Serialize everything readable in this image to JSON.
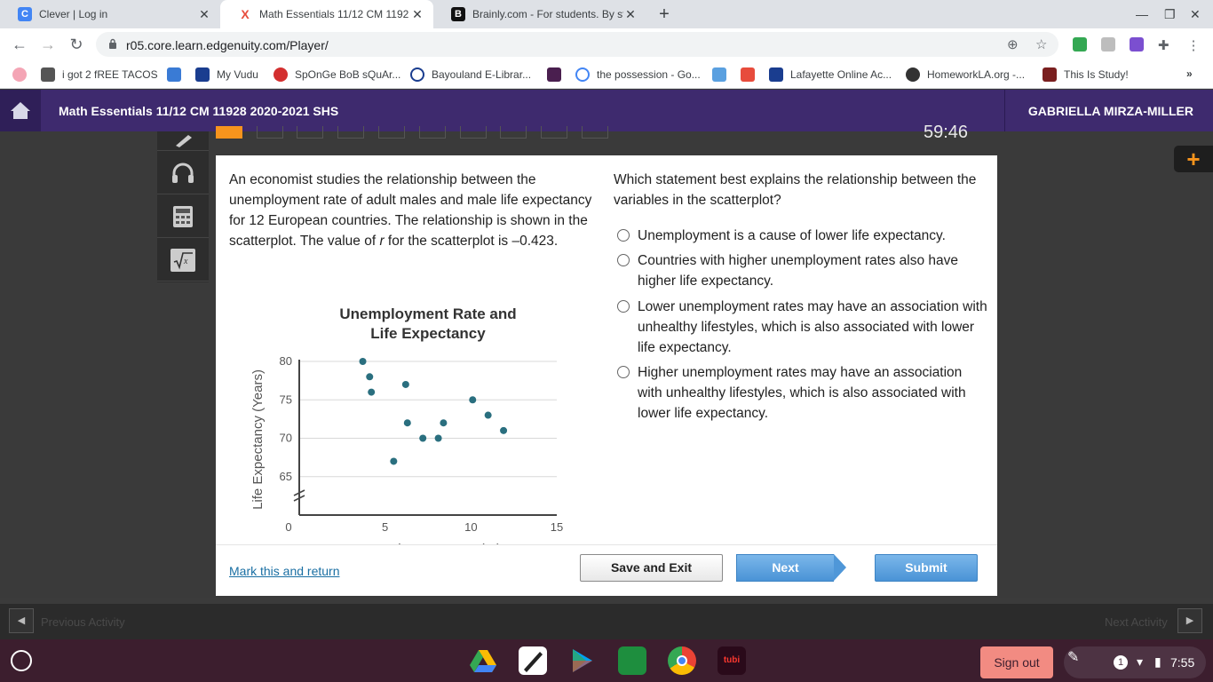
{
  "browser": {
    "tabs": [
      {
        "title": "Clever | Log in",
        "favicon_letter": "C",
        "favicon_color": "#4285f4"
      },
      {
        "title": "Math Essentials 11/12 CM 1192",
        "favicon_letter": "X",
        "favicon_color": "#e74c3c"
      },
      {
        "title": "Brainly.com - For students. By st",
        "favicon_letter": "B",
        "favicon_color": "#111111"
      }
    ],
    "url": "r05.core.learn.edgenuity.com/Player/",
    "bookmarks": [
      "i got 2 fREE TACOS",
      "My Vudu",
      "SpOnGe BoB sQuAr...",
      "Bayouland E-Librar...",
      "the possession - Go...",
      "Lafayette Online Ac...",
      "HomeworkLA.org -...",
      "This Is Study!"
    ]
  },
  "app": {
    "course_title": "Math Essentials 11/12 CM 11928 2020-2021 SHS",
    "user_name": "GABRIELLA MIRZA-MILLER",
    "timer": "59:46"
  },
  "question": {
    "prompt": "An economist studies the relationship between the unemployment rate of adult males and male life expectancy for 12 European countries. The relationship is shown in the scatterplot. The value of r for the scatterplot is –0.423.",
    "stem": "Which statement best explains the relationship between the variables in the scatterplot?",
    "options": [
      "Unemployment is a cause of lower life expectancy.",
      "Countries with higher unemployment rates also have higher life expectancy.",
      "Lower unemployment rates may have an association with unhealthy lifestyles, which is also associated with lower life expectancy.",
      "Higher unemployment rates may have an association with unhealthy lifestyles, which is also associated with lower life expectancy."
    ]
  },
  "chart_data": {
    "type": "scatter",
    "title": "Unemployment Rate and Life Expectancy",
    "title_lines": [
      "Unemployment Rate and",
      "Life Expectancy"
    ],
    "xlabel": "Unemployment Rate (%)",
    "ylabel": "Life Expectancy (Years)",
    "xlim": [
      0,
      15
    ],
    "ylim": [
      60,
      80
    ],
    "xticks": [
      0,
      5,
      10,
      15
    ],
    "yticks": [
      65,
      70,
      75,
      80
    ],
    "point_color": "#2a6f7f",
    "points": [
      {
        "x": 3.7,
        "y": 80
      },
      {
        "x": 4.1,
        "y": 78
      },
      {
        "x": 4.2,
        "y": 76
      },
      {
        "x": 6.2,
        "y": 77
      },
      {
        "x": 6.3,
        "y": 72
      },
      {
        "x": 5.5,
        "y": 67
      },
      {
        "x": 7.2,
        "y": 70
      },
      {
        "x": 8.1,
        "y": 70
      },
      {
        "x": 8.4,
        "y": 72
      },
      {
        "x": 10.1,
        "y": 75
      },
      {
        "x": 11.0,
        "y": 73
      },
      {
        "x": 11.9,
        "y": 71
      }
    ]
  },
  "footer": {
    "mark_label": "Mark this and return",
    "save_label": "Save and Exit",
    "next_label": "Next",
    "submit_label": "Submit"
  },
  "activity_bar": {
    "prev_label": "Previous Activity",
    "next_label": "Next Activity"
  },
  "shelf": {
    "signout_label": "Sign out",
    "notification_count": "1",
    "time": "7:55"
  }
}
